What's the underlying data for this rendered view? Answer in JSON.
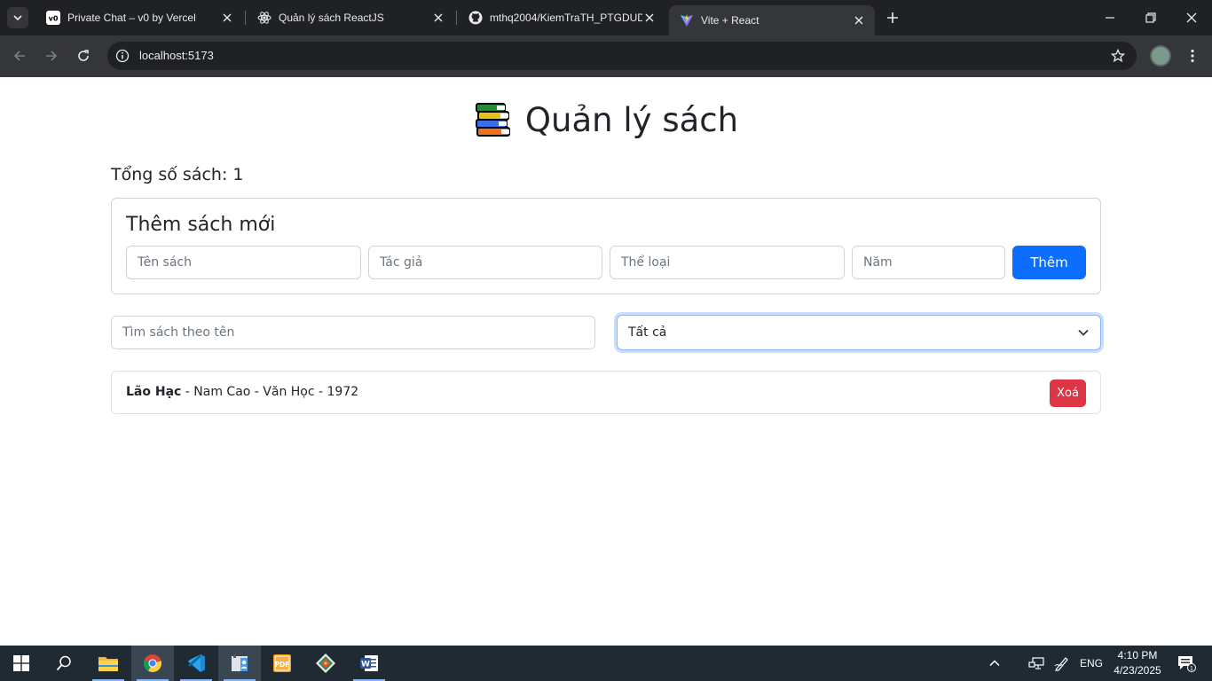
{
  "browser": {
    "tabs": [
      {
        "title": "Private Chat – v0 by Vercel",
        "icon": "v0-icon"
      },
      {
        "title": "Quản lý sách ReactJS",
        "icon": "react-icon"
      },
      {
        "title": "mthq2004/KiemTraTH_PTGDUD",
        "icon": "github-icon"
      },
      {
        "title": "Vite + React",
        "icon": "vite-icon",
        "active": true
      }
    ],
    "url": "localhost:5173"
  },
  "app": {
    "title": "Quản lý sách",
    "total_label": "Tổng số sách: 1",
    "add_form": {
      "heading": "Thêm sách mới",
      "name_placeholder": "Tên sách",
      "author_placeholder": "Tác giả",
      "genre_placeholder": "Thể loại",
      "year_placeholder": "Năm",
      "add_label": "Thêm"
    },
    "search_placeholder": "Tìm sách theo tên",
    "filter_selected": "Tất cả",
    "books": [
      {
        "title": "Lão Hạc",
        "details": " - Nam Cao - Văn Học - 1972",
        "delete_label": "Xoá"
      }
    ]
  },
  "taskbar": {
    "apps": [
      "start-icon",
      "search-icon",
      "file-explorer-icon",
      "chrome-icon",
      "vscode-icon",
      "contacts-app-icon",
      "pdf-icon",
      "git-icon",
      "word-icon"
    ],
    "language": "ENG",
    "time": "4:10 PM",
    "date": "4/23/2025",
    "notification_count": "1"
  },
  "colors": {
    "primary": "#0d6efd",
    "danger": "#dc3545",
    "chrome_dark": "#202124",
    "chrome_toolbar": "#35363a",
    "taskbar": "#1f2a33"
  }
}
